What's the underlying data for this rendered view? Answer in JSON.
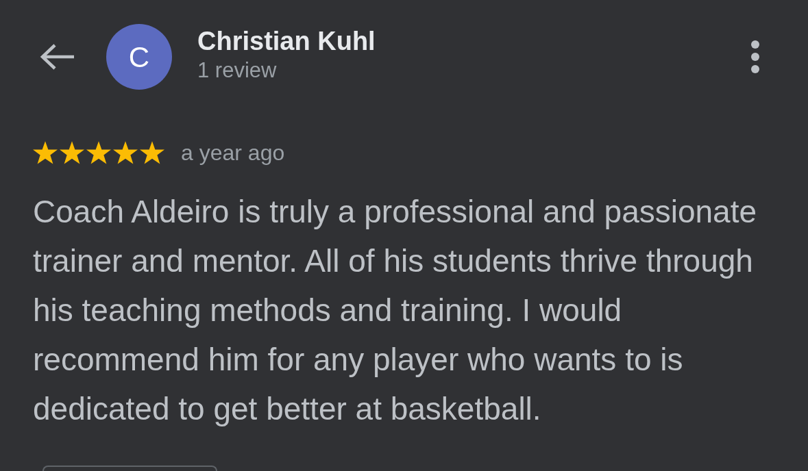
{
  "reviewer": {
    "initial": "C",
    "name": "Christian Kuhl",
    "review_count": "1 review"
  },
  "review": {
    "stars": 5,
    "time": "a year ago",
    "text": "Coach Aldeiro is truly a professional and passionate trainer and mentor. All of his students thrive through his teaching methods and training. I would recommend him for any player who wants to is dedicated to get better at basketball."
  }
}
